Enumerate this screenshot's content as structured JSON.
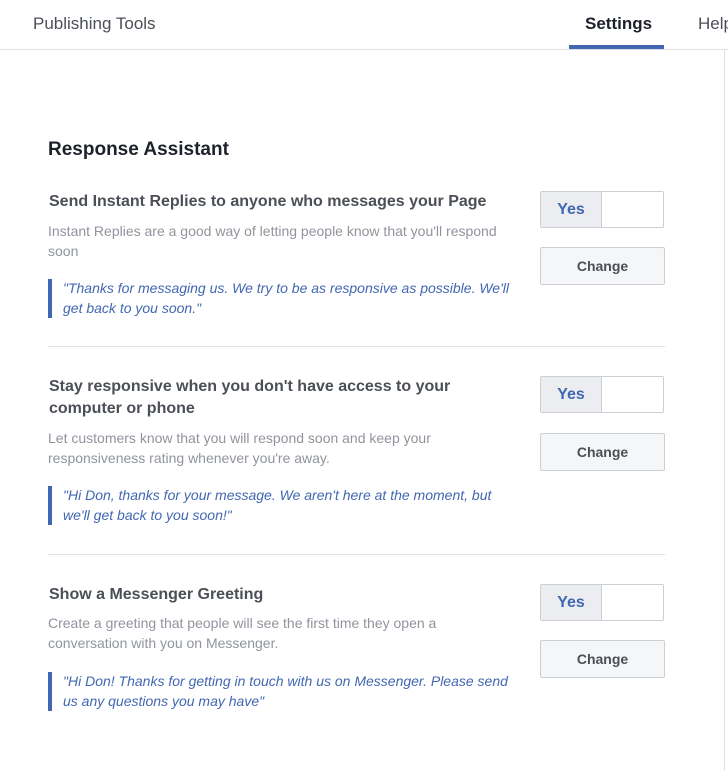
{
  "header": {
    "brand": "Publishing Tools",
    "tabs": [
      {
        "label": "Settings",
        "active": true
      },
      {
        "label": "Help"
      }
    ]
  },
  "section": {
    "title": "Response Assistant"
  },
  "items": [
    {
      "title": "Send Instant Replies to anyone who messages your Page",
      "description": "Instant Replies are a good way of letting people know that you'll respond soon",
      "message": "\"Thanks for messaging us. We try to be as responsive as possible. We'll get back to you soon.\"",
      "toggle_label": "Yes",
      "toggle_on": true,
      "change_label": "Change"
    },
    {
      "title": "Stay responsive when you don't have access to your computer or phone",
      "description": "Let customers know that you will respond soon and keep your responsiveness rating whenever you're away.",
      "message": "\"Hi Don, thanks for your message. We aren't here at the moment, but we'll get back to you soon!\"",
      "toggle_label": "Yes",
      "toggle_on": true,
      "change_label": "Change"
    },
    {
      "title": "Show a Messenger Greeting",
      "description": "Create a greeting that people will see the first time they open a conversation with you on Messenger.",
      "message": "\"Hi Don! Thanks for getting in touch with us on Messenger. Please send us any questions you may have\"",
      "toggle_label": "Yes",
      "toggle_on": true,
      "change_label": "Change"
    }
  ],
  "colors": {
    "accent": "#4267b2",
    "muted_text": "#90949c",
    "border": "#dddfe2"
  }
}
